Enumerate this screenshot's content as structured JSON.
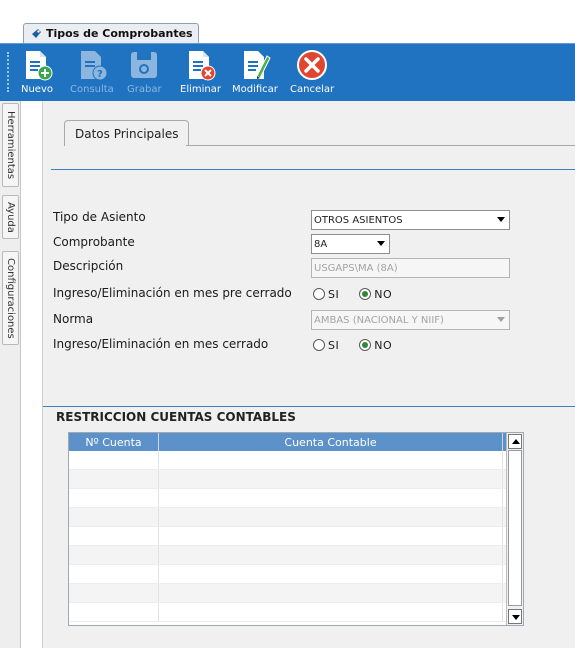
{
  "document_tab": {
    "title": "Tipos de Comprobantes"
  },
  "toolbar": {
    "buttons": [
      {
        "label": "Nuevo",
        "icon": "new-document-icon",
        "enabled": true
      },
      {
        "label": "Consulta",
        "icon": "query-document-icon",
        "enabled": false
      },
      {
        "label": "Grabar",
        "icon": "save-disk-icon",
        "enabled": false
      },
      {
        "label": "Eliminar",
        "icon": "delete-document-icon",
        "enabled": true
      },
      {
        "label": "Modificar",
        "icon": "edit-document-icon",
        "enabled": true
      },
      {
        "label": "Cancelar",
        "icon": "cancel-icon",
        "enabled": true
      }
    ]
  },
  "side_tabs": [
    "Herramientas",
    "Ayuda",
    "Configuraciones"
  ],
  "form": {
    "tab_label": "Datos Principales",
    "tipo_asiento": {
      "label": "Tipo de Asiento",
      "value": "OTROS ASIENTOS"
    },
    "comprobante": {
      "label": "Comprobante",
      "value": "8A"
    },
    "descripcion": {
      "label": "Descripción",
      "value": "USGAPS\\MA (8A)"
    },
    "pre_cerrado": {
      "label": "Ingreso/Eliminación en mes pre cerrado",
      "options": [
        "SI",
        "NO"
      ],
      "selected": "NO"
    },
    "norma": {
      "label": "Norma",
      "value": "AMBAS (NACIONAL Y NIIF)"
    },
    "cerrado": {
      "label": "Ingreso/Eliminación en mes cerrado",
      "options": [
        "SI",
        "NO"
      ],
      "selected": "NO"
    }
  },
  "restricciones": {
    "title": "RESTRICCION CUENTAS CONTABLES",
    "columns": [
      "Nº Cuenta",
      "Cuenta Contable"
    ],
    "rows": []
  },
  "colors": {
    "toolbar": "#1f73c1",
    "grid_header": "#5d91c9",
    "separator": "#3d7fbf",
    "radio_selected": "#2c8a36"
  }
}
